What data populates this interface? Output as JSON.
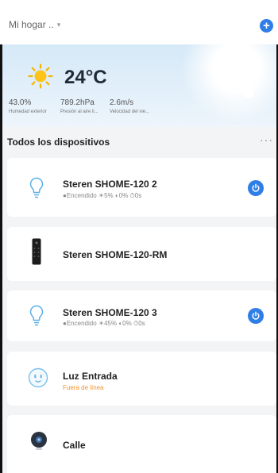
{
  "header": {
    "home_label": "Mi hogar ..",
    "caret": "▾",
    "add_symbol": "+"
  },
  "weather": {
    "temperature": "24°C",
    "humidity_value": "43.0%",
    "humidity_label": "Humedad exterior",
    "pressure_value": "789.2hPa",
    "pressure_label": "Presión al aire li...",
    "wind_value": "2.6m/s",
    "wind_label": "Velocidad del vie..."
  },
  "devices_section": {
    "title": "Todos los dispositivos",
    "more": "···"
  },
  "devices": [
    {
      "name": "Steren SHOME-120 2",
      "status_state": "Encendido",
      "brightness": "5%",
      "color_temp": "0%",
      "timer": "0s",
      "icon": "bulb-icon",
      "has_power": true
    },
    {
      "name": "Steren SHOME-120-RM",
      "icon": "remote-icon",
      "has_power": false
    },
    {
      "name": "Steren SHOME-120 3",
      "status_state": "Encendido",
      "brightness": "45%",
      "color_temp": "0%",
      "timer": "0s",
      "icon": "bulb-icon",
      "has_power": true
    },
    {
      "name": "Luz Entrada",
      "status_text": "Fuera de línea",
      "icon": "plug-icon",
      "has_power": false
    },
    {
      "name": "Calle",
      "icon": "camera-icon",
      "has_power": false
    }
  ],
  "colors": {
    "accent": "#2f7ee6",
    "offline": "#f0922b",
    "background": "#f3f4f6"
  }
}
